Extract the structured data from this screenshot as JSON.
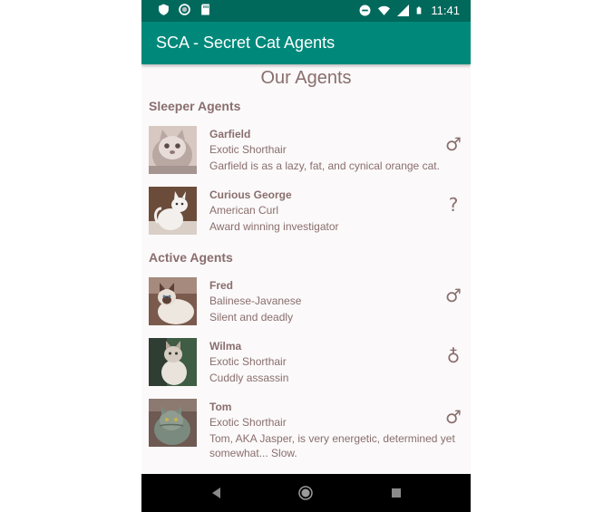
{
  "status_bar": {
    "time": "11:41",
    "icons": [
      "shield-icon",
      "circle-icon",
      "sd-card-icon",
      "do-not-disturb-icon",
      "wifi-icon",
      "signal-icon",
      "battery-icon"
    ]
  },
  "app_bar": {
    "title": "SCA - Secret Cat Agents"
  },
  "page": {
    "title": "Our Agents"
  },
  "sections": [
    {
      "header": "Sleeper Agents",
      "agents": [
        {
          "name": "Garfield",
          "breed": "Exotic Shorthair",
          "description": "Garfield is as a lazy, fat, and cynical orange cat.",
          "gender_symbol": "♂",
          "gender": "male"
        },
        {
          "name": "Curious George",
          "breed": "American Curl",
          "description": "Award winning investigator",
          "gender_symbol": "?",
          "gender": "unknown"
        }
      ]
    },
    {
      "header": "Active Agents",
      "agents": [
        {
          "name": "Fred",
          "breed": "Balinese-Javanese",
          "description": "Silent and deadly",
          "gender_symbol": "♂",
          "gender": "male"
        },
        {
          "name": "Wilma",
          "breed": "Exotic Shorthair",
          "description": "Cuddly assassin",
          "gender_symbol": "♁",
          "gender": "female"
        },
        {
          "name": "Tom",
          "breed": "Exotic Shorthair",
          "description": "Tom, AKA Jasper, is very energetic, determined yet somewhat... Slow.",
          "gender_symbol": "♂",
          "gender": "male"
        }
      ]
    }
  ],
  "nav_bar": {
    "icons": [
      "back-icon",
      "home-icon",
      "recents-icon"
    ]
  },
  "colors": {
    "status_bar": "#00695c",
    "app_bar": "#00897b",
    "text": "#8a6e6e",
    "background": "#fbf9f9"
  }
}
